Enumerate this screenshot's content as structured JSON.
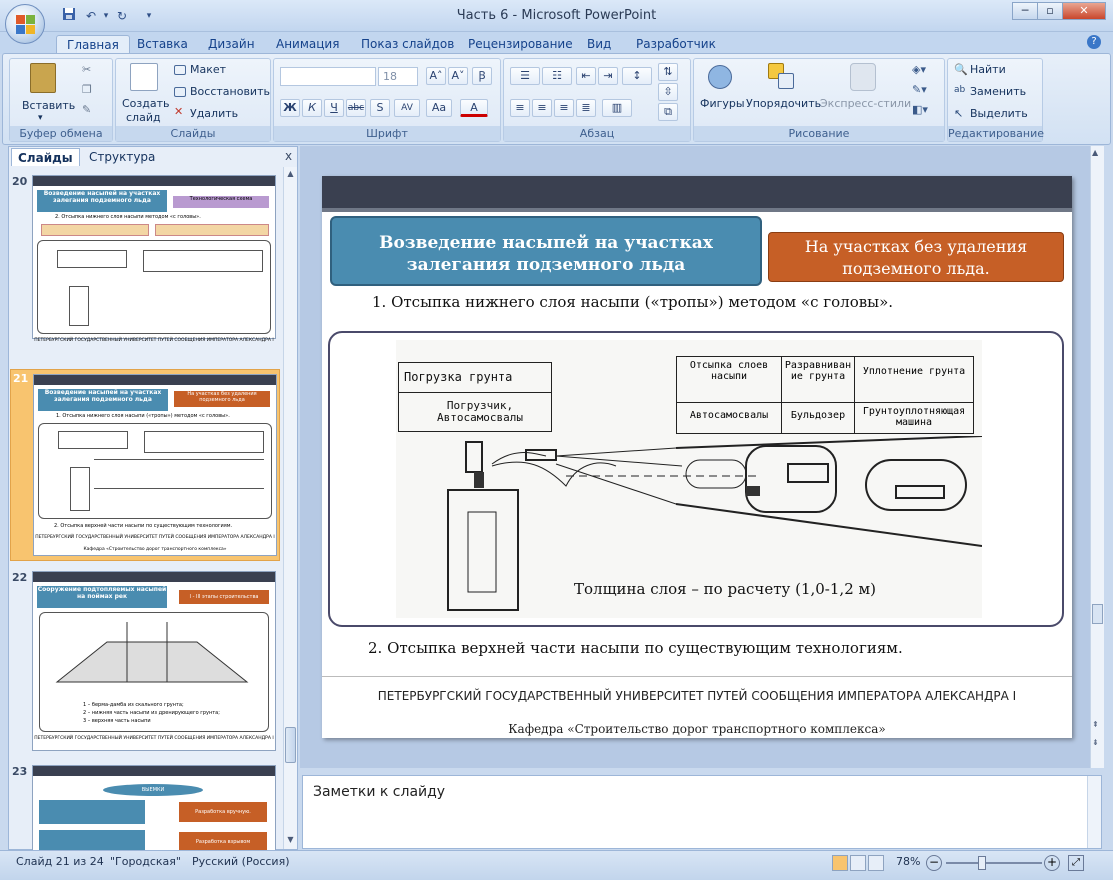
{
  "window": {
    "title": "Часть 6 - Microsoft PowerPoint"
  },
  "qat": {
    "save": "save-icon",
    "undo": "undo-icon",
    "redo": "redo-icon"
  },
  "tabs": [
    "Главная",
    "Вставка",
    "Дизайн",
    "Анимация",
    "Показ слайдов",
    "Рецензирование",
    "Вид",
    "Разработчик"
  ],
  "ribbon": {
    "clipboard": {
      "label": "Буфер обмена",
      "paste": "Вставить"
    },
    "slides": {
      "label": "Слайды",
      "create": "Создать",
      "create2": "слайд",
      "layout": "Макет",
      "reset": "Восстановить",
      "delete": "Удалить"
    },
    "font": {
      "label": "Шрифт",
      "size": "18",
      "bold": "Ж",
      "italic": "К",
      "underline": "Ч",
      "strike": "abc",
      "shadow": "S",
      "spacing": "AV",
      "case": "Aa",
      "color": "A"
    },
    "paragraph": {
      "label": "Абзац"
    },
    "drawing": {
      "label": "Рисование",
      "shapes": "Фигуры",
      "arrange": "Упорядочить",
      "styles": "Экспресс-стили"
    },
    "editing": {
      "label": "Редактирование",
      "find": "Найти",
      "replace": "Заменить",
      "select": "Выделить"
    }
  },
  "leftpane": {
    "tab_slides": "Слайды",
    "tab_outline": "Структура",
    "close": "x",
    "slides": [
      {
        "num": "20",
        "title": "Возведение насыпей на участках залегания подземного льда",
        "side": "Технологическая схема",
        "line": "2. Отсыпка нижнего слоя насыпи методом «с головы».",
        "footer": "ПЕТЕРБУРГСКИЙ ГОСУДАРСТВЕННЫЙ УНИВЕРСИТЕТ ПУТЕЙ СООБЩЕНИЯ ИМПЕРАТОРА АЛЕКСАНДРА I",
        "footer2": "Кафедра «Строительство дорог транспортного комплекса»"
      },
      {
        "num": "21",
        "title": "Возведение насыпей на участках залегания подземного льда",
        "side": "На участках без удаления подземного льда",
        "line": "1. Отсыпка нижнего слоя насыпи («тропы») методом «с головы».",
        "line2": "2. Отсыпка верхней части насыпи по существующим технологиям.",
        "footer": "ПЕТЕРБУРГСКИЙ ГОСУДАРСТВЕННЫЙ УНИВЕРСИТЕТ ПУТЕЙ СООБЩЕНИЯ ИМПЕРАТОРА АЛЕКСАНДРА I",
        "footer2": "Кафедра «Строительство дорог транспортного комплекса»"
      },
      {
        "num": "22",
        "title": "Сооружение подтопляемых насыпей на поймах рек",
        "side": "I - III этапы строительства",
        "legend1": "1 – берма-дамба из скального грунта;",
        "legend2": "2 – нижняя часть насыпи из дренирующего грунта;",
        "legend3": "3 – верхняя часть насыпи",
        "footer": "ПЕТЕРБУРГСКИЙ ГОСУДАРСТВЕННЫЙ УНИВЕРСИТЕТ ПУТЕЙ СООБЩЕНИЯ ИМПЕРАТОРА АЛЕКСАНДРА I",
        "footer2": "Кафедра «Строительство дорог транспортного комплекса»"
      },
      {
        "num": "23",
        "title": "ВЫЕМКИ",
        "box1": "Разработка вручную.",
        "box2": "Разработка взрывом"
      }
    ]
  },
  "slide": {
    "title": "Возведение насыпей на участках залегания подземного льда",
    "side": "На участках без удаления подземного льда.",
    "line1": "1. Отсыпка нижнего слоя насыпи («тропы») методом «с головы».",
    "diagram": {
      "loading": "Погрузка грунта",
      "loader": "Погрузчик, Автосамосвалы",
      "col1": "Отсыпка слоев насыпи",
      "col2": "Разравнивание грунта",
      "col3": "Уплотнение грунта",
      "r1": "Автосамосвалы",
      "r2": "Бульдозер",
      "r3": "Грунтоуплотняющая машина",
      "thickness": "Толщина слоя – по расчету (1,0-1,2 м)"
    },
    "line2": "2. Отсыпка верхней части насыпи по существующим технологиям.",
    "footer": "ПЕТЕРБУРГСКИЙ ГОСУДАРСТВЕННЫЙ УНИВЕРСИТЕТ ПУТЕЙ СООБЩЕНИЯ ИМПЕРАТОРА АЛЕКСАНДРА I",
    "footer2": "Кафедра «Строительство дорог транспортного комплекса»"
  },
  "notes": {
    "placeholder": "Заметки к слайду"
  },
  "status": {
    "slide": "Слайд 21 из 24",
    "theme": "\"Городская\"",
    "lang": "Русский (Россия)",
    "zoom": "78%",
    "zoom_fraction": 0.78
  },
  "colors": {
    "title_box": "#4a8cb0",
    "side_box": "#c65f26",
    "accent_bar": "#3a4050"
  }
}
